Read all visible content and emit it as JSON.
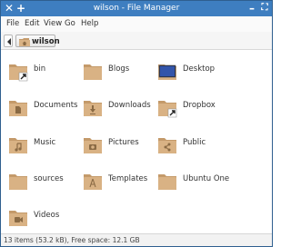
{
  "window": {
    "title": "wilson - File Manager",
    "buttons": {
      "close": "✕",
      "add": "+",
      "minimize": "–",
      "maximize": "⛶"
    }
  },
  "menu": {
    "file": "File",
    "edit": "Edit",
    "view": "View",
    "go": "Go",
    "help": "Help"
  },
  "location": {
    "crumb": "wilson",
    "back_icon": "chevron-left-icon",
    "crumb_icon": "home-folder-icon"
  },
  "items": [
    {
      "label": "bin",
      "icon": "folder-link-icon"
    },
    {
      "label": "Blogs",
      "icon": "folder-icon"
    },
    {
      "label": "Desktop",
      "icon": "desktop-folder-icon"
    },
    {
      "label": "Documents",
      "icon": "documents-folder-icon"
    },
    {
      "label": "Downloads",
      "icon": "downloads-folder-icon"
    },
    {
      "label": "Dropbox",
      "icon": "folder-link-icon"
    },
    {
      "label": "Music",
      "icon": "music-folder-icon"
    },
    {
      "label": "Pictures",
      "icon": "pictures-folder-icon"
    },
    {
      "label": "Public",
      "icon": "public-folder-icon"
    },
    {
      "label": "sources",
      "icon": "folder-icon"
    },
    {
      "label": "Templates",
      "icon": "templates-folder-icon"
    },
    {
      "label": "Ubuntu One",
      "icon": "folder-icon"
    },
    {
      "label": "Videos",
      "icon": "videos-folder-icon"
    }
  ],
  "status": "13 items (53.2 kB), Free space: 12.1 GB",
  "colors": {
    "titlebar": "#3e7ec0",
    "folder_body": "#d9b284",
    "folder_tab": "#c49a6a",
    "folder_symbol": "#8a6a44"
  }
}
